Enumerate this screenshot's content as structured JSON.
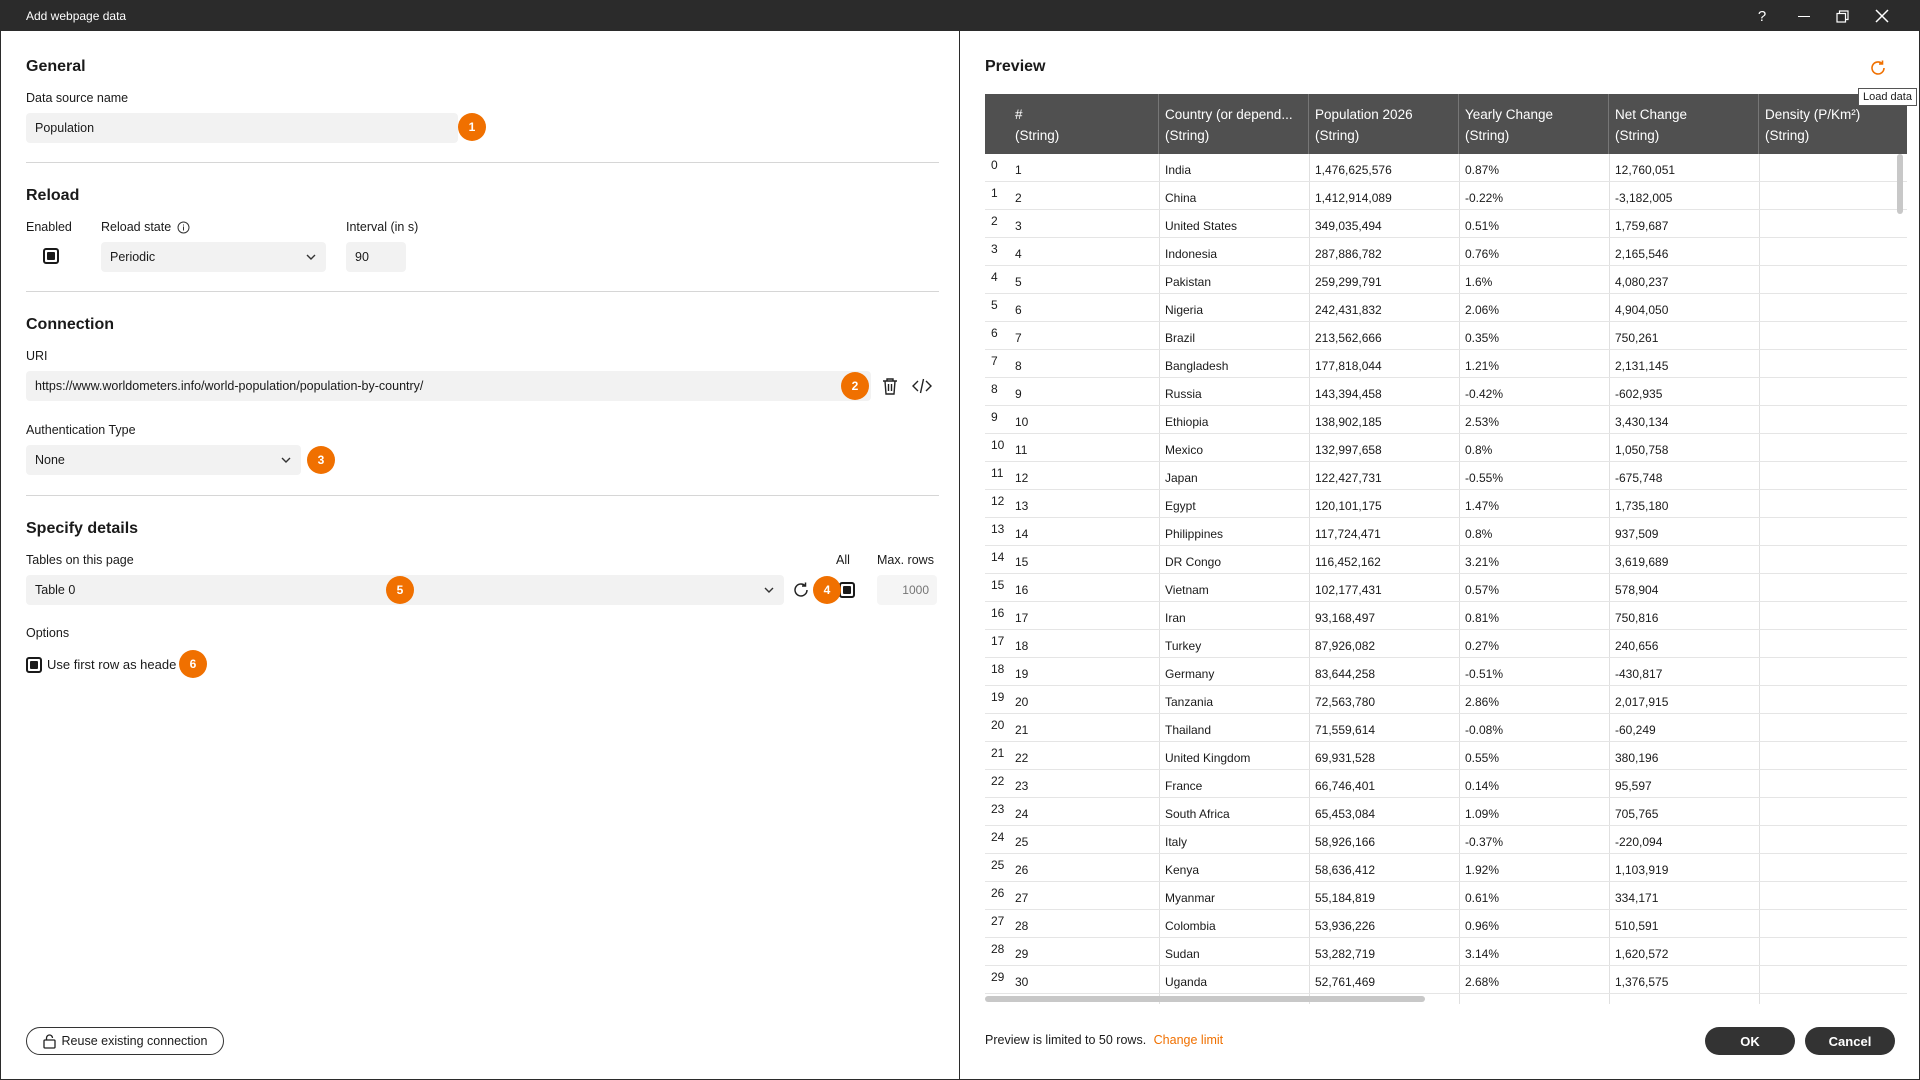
{
  "window": {
    "title": "Add webpage data",
    "help_glyph": "?",
    "minimize_glyph": "—",
    "maximize_glyph": "❐",
    "close_glyph": "✕"
  },
  "general": {
    "title": "General",
    "data_source_label": "Data source name",
    "data_source_value": "Population",
    "badge": "1"
  },
  "reload": {
    "title": "Reload",
    "enabled_label": "Enabled",
    "enabled": true,
    "reload_state_label": "Reload state",
    "reload_state_value": "Periodic",
    "interval_label": "Interval (in s)",
    "interval_value": "90"
  },
  "connection": {
    "title": "Connection",
    "uri_label": "URI",
    "uri_value": "https://www.worldometers.info/world-population/population-by-country/",
    "uri_badge": "2",
    "auth_label": "Authentication Type",
    "auth_value": "None",
    "auth_badge": "3"
  },
  "details": {
    "title": "Specify details",
    "tables_label": "Tables on this page",
    "table_value": "Table 0",
    "table_badge": "5",
    "refresh_badge": "4",
    "all_label": "All",
    "max_rows_label": "Max. rows",
    "max_rows_placeholder": "1000",
    "options_label": "Options",
    "first_row_label": "Use first row as heade",
    "first_row_checked": true,
    "first_row_badge": "6"
  },
  "footer_left": {
    "reuse_label": "Reuse existing connection"
  },
  "preview": {
    "title": "Preview",
    "load_data_tooltip": "Load data",
    "limit_text": "Preview is limited to 50 rows.",
    "change_limit": "Change limit",
    "ok_label": "OK",
    "cancel_label": "Cancel",
    "columns": [
      {
        "name": "#",
        "type": "(String)"
      },
      {
        "name": "Country (or depend...",
        "type": "(String)"
      },
      {
        "name": "Population 2026",
        "type": "(String)"
      },
      {
        "name": "Yearly Change",
        "type": "(String)"
      },
      {
        "name": "Net Change",
        "type": "(String)"
      },
      {
        "name": "Density (P/Km²)",
        "type": "(String)"
      }
    ],
    "rows": [
      {
        "idx": "0",
        "n": "1",
        "country": "India",
        "pop": "1,476,625,576",
        "yearly": "0.87%",
        "net": "12,760,051"
      },
      {
        "idx": "1",
        "n": "2",
        "country": "China",
        "pop": "1,412,914,089",
        "yearly": "-0.22%",
        "net": "-3,182,005"
      },
      {
        "idx": "2",
        "n": "3",
        "country": "United States",
        "pop": "349,035,494",
        "yearly": "0.51%",
        "net": "1,759,687"
      },
      {
        "idx": "3",
        "n": "4",
        "country": "Indonesia",
        "pop": "287,886,782",
        "yearly": "0.76%",
        "net": "2,165,546"
      },
      {
        "idx": "4",
        "n": "5",
        "country": "Pakistan",
        "pop": "259,299,791",
        "yearly": "1.6%",
        "net": "4,080,237"
      },
      {
        "idx": "5",
        "n": "6",
        "country": "Nigeria",
        "pop": "242,431,832",
        "yearly": "2.06%",
        "net": "4,904,050"
      },
      {
        "idx": "6",
        "n": "7",
        "country": "Brazil",
        "pop": "213,562,666",
        "yearly": "0.35%",
        "net": "750,261"
      },
      {
        "idx": "7",
        "n": "8",
        "country": "Bangladesh",
        "pop": "177,818,044",
        "yearly": "1.21%",
        "net": "2,131,145"
      },
      {
        "idx": "8",
        "n": "9",
        "country": "Russia",
        "pop": "143,394,458",
        "yearly": "-0.42%",
        "net": "-602,935"
      },
      {
        "idx": "9",
        "n": "10",
        "country": "Ethiopia",
        "pop": "138,902,185",
        "yearly": "2.53%",
        "net": "3,430,134"
      },
      {
        "idx": "10",
        "n": "11",
        "country": "Mexico",
        "pop": "132,997,658",
        "yearly": "0.8%",
        "net": "1,050,758"
      },
      {
        "idx": "11",
        "n": "12",
        "country": "Japan",
        "pop": "122,427,731",
        "yearly": "-0.55%",
        "net": "-675,748"
      },
      {
        "idx": "12",
        "n": "13",
        "country": "Egypt",
        "pop": "120,101,175",
        "yearly": "1.47%",
        "net": "1,735,180"
      },
      {
        "idx": "13",
        "n": "14",
        "country": "Philippines",
        "pop": "117,724,471",
        "yearly": "0.8%",
        "net": "937,509"
      },
      {
        "idx": "14",
        "n": "15",
        "country": "DR Congo",
        "pop": "116,452,162",
        "yearly": "3.21%",
        "net": "3,619,689"
      },
      {
        "idx": "15",
        "n": "16",
        "country": "Vietnam",
        "pop": "102,177,431",
        "yearly": "0.57%",
        "net": "578,904"
      },
      {
        "idx": "16",
        "n": "17",
        "country": "Iran",
        "pop": "93,168,497",
        "yearly": "0.81%",
        "net": "750,816"
      },
      {
        "idx": "17",
        "n": "18",
        "country": "Turkey",
        "pop": "87,926,082",
        "yearly": "0.27%",
        "net": "240,656"
      },
      {
        "idx": "18",
        "n": "19",
        "country": "Germany",
        "pop": "83,644,258",
        "yearly": "-0.51%",
        "net": "-430,817"
      },
      {
        "idx": "19",
        "n": "20",
        "country": "Tanzania",
        "pop": "72,563,780",
        "yearly": "2.86%",
        "net": "2,017,915"
      },
      {
        "idx": "20",
        "n": "21",
        "country": "Thailand",
        "pop": "71,559,614",
        "yearly": "-0.08%",
        "net": "-60,249"
      },
      {
        "idx": "21",
        "n": "22",
        "country": "United Kingdom",
        "pop": "69,931,528",
        "yearly": "0.55%",
        "net": "380,196"
      },
      {
        "idx": "22",
        "n": "23",
        "country": "France",
        "pop": "66,746,401",
        "yearly": "0.14%",
        "net": "95,597"
      },
      {
        "idx": "23",
        "n": "24",
        "country": "South Africa",
        "pop": "65,453,084",
        "yearly": "1.09%",
        "net": "705,765"
      },
      {
        "idx": "24",
        "n": "25",
        "country": "Italy",
        "pop": "58,926,166",
        "yearly": "-0.37%",
        "net": "-220,094"
      },
      {
        "idx": "25",
        "n": "26",
        "country": "Kenya",
        "pop": "58,636,412",
        "yearly": "1.92%",
        "net": "1,103,919"
      },
      {
        "idx": "26",
        "n": "27",
        "country": "Myanmar",
        "pop": "55,184,819",
        "yearly": "0.61%",
        "net": "334,171"
      },
      {
        "idx": "27",
        "n": "28",
        "country": "Colombia",
        "pop": "53,936,226",
        "yearly": "0.96%",
        "net": "510,591"
      },
      {
        "idx": "28",
        "n": "29",
        "country": "Sudan",
        "pop": "53,282,719",
        "yearly": "3.14%",
        "net": "1,620,572"
      },
      {
        "idx": "29",
        "n": "30",
        "country": "Uganda",
        "pop": "52,761,469",
        "yearly": "2.68%",
        "net": "1,376,575"
      }
    ]
  },
  "colors": {
    "accent_orange": "#f07000",
    "header_dark": "#505050",
    "titlebar": "#2b2b2b"
  }
}
